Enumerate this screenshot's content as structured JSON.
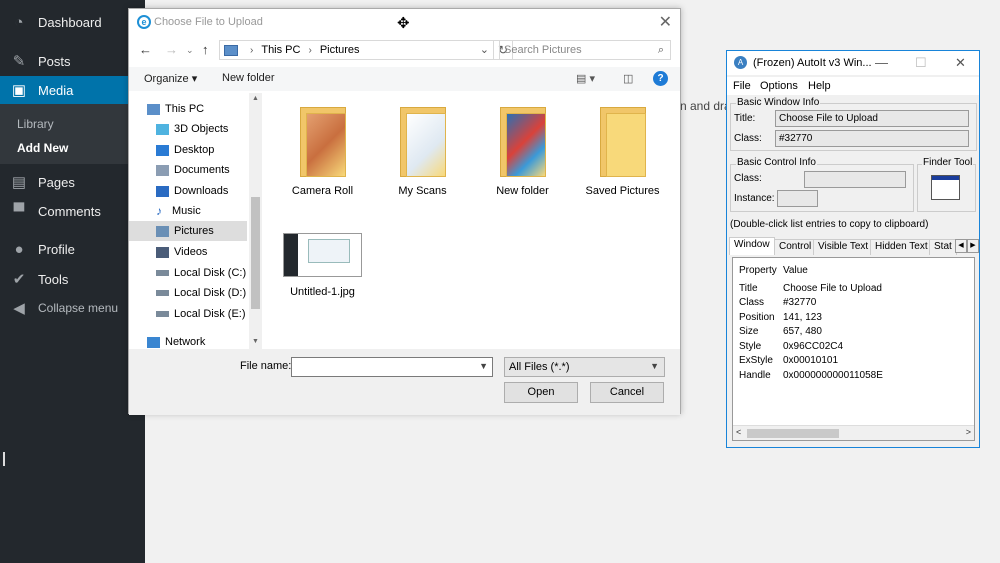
{
  "wp_sidebar": {
    "items": [
      {
        "label": "Dashboard",
        "icon": "dashboard-icon"
      },
      {
        "label": "Posts",
        "icon": "pin-icon"
      },
      {
        "label": "Media",
        "icon": "media-icon"
      },
      {
        "label": "Pages",
        "icon": "pages-icon"
      },
      {
        "label": "Comments",
        "icon": "comments-icon"
      },
      {
        "label": "Profile",
        "icon": "profile-icon"
      },
      {
        "label": "Tools",
        "icon": "wrench-icon"
      },
      {
        "label": "Collapse menu",
        "icon": "collapse-icon"
      }
    ],
    "submenu": [
      "Library",
      "Add New"
    ],
    "accent_color": "#0073aa"
  },
  "background_text": "n and drag",
  "file_dialog": {
    "title": "Choose File to Upload",
    "address": [
      "This PC",
      "Pictures"
    ],
    "search_placeholder": "Search Pictures",
    "toolbar": {
      "organize": "Organize ▾",
      "new_folder": "New folder"
    },
    "nav": [
      "This PC",
      "3D Objects",
      "Desktop",
      "Documents",
      "Downloads",
      "Music",
      "Pictures",
      "Videos",
      "Local Disk (C:)",
      "Local Disk (D:)",
      "Local Disk (E:)",
      "Network"
    ],
    "items": [
      "Camera Roll",
      "My Scans",
      "New folder",
      "Saved Pictures",
      "Untitled-1.jpg"
    ],
    "filename_label": "File name:",
    "filetype": "All Files (*.*)",
    "open": "Open",
    "cancel": "Cancel"
  },
  "autoit": {
    "title": "(Frozen) AutoIt v3 Win...",
    "menu": [
      "File",
      "Options",
      "Help"
    ],
    "basic_window_info": "Basic Window Info",
    "title_label": "Title:",
    "title_value": "Choose File to Upload",
    "class_label": "Class:",
    "class_value": "#32770",
    "basic_control_info": "Basic Control Info",
    "control_class_label": "Class:",
    "instance_label": "Instance:",
    "finder_tool": "Finder Tool",
    "hint": "(Double-click list entries to copy to clipboard)",
    "tabs": [
      "Window",
      "Control",
      "Visible Text",
      "Hidden Text",
      "Stat"
    ],
    "list_header": {
      "property": "Property",
      "value": "Value"
    },
    "rows": [
      {
        "k": "Title",
        "v": "Choose File to Upload"
      },
      {
        "k": "Class",
        "v": "#32770"
      },
      {
        "k": "Position",
        "v": "141, 123"
      },
      {
        "k": "Size",
        "v": "657, 480"
      },
      {
        "k": "Style",
        "v": "0x96CC02C4"
      },
      {
        "k": "ExStyle",
        "v": "0x00010101"
      },
      {
        "k": "Handle",
        "v": "0x000000000011058E"
      }
    ]
  }
}
